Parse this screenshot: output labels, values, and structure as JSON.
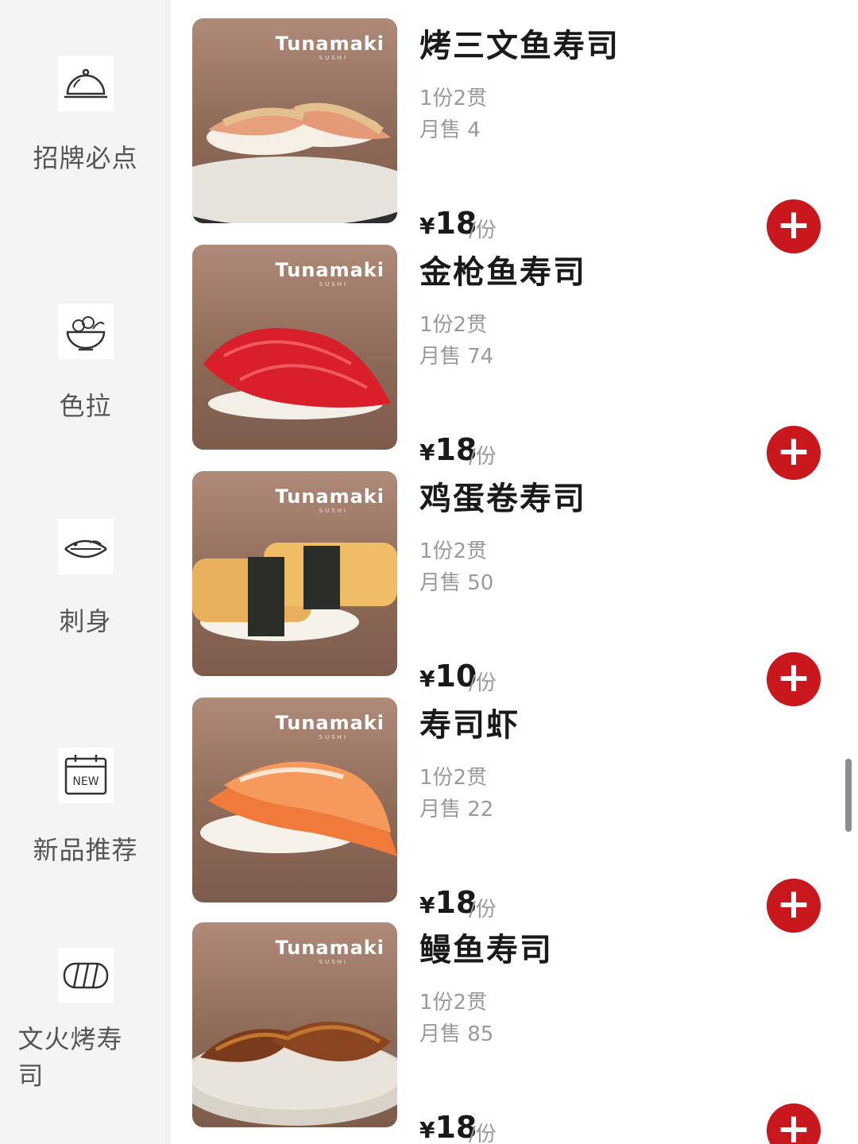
{
  "sidebar": {
    "categories": [
      {
        "label": "招牌必点",
        "icon": "cloche-icon"
      },
      {
        "label": "色拉",
        "icon": "salad-bowl-icon"
      },
      {
        "label": "刺身",
        "icon": "sashimi-icon"
      },
      {
        "label": "新品推荐",
        "icon": "new-calendar-icon",
        "icon_text": "NEW"
      },
      {
        "label": "文火烤寿司",
        "icon": "grilled-sushi-icon"
      }
    ]
  },
  "brand": {
    "name": "Tunamaki",
    "sub": "SUSHI"
  },
  "products": [
    {
      "name": "烤三文鱼寿司",
      "spec": "1份2贯",
      "sold": "月售 4",
      "currency": "¥",
      "price": "18",
      "unit": "/份"
    },
    {
      "name": "金枪鱼寿司",
      "spec": "1份2贯",
      "sold": "月售 74",
      "currency": "¥",
      "price": "18",
      "unit": "/份"
    },
    {
      "name": "鸡蛋卷寿司",
      "spec": "1份2贯",
      "sold": "月售 50",
      "currency": "¥",
      "price": "10",
      "unit": "/份"
    },
    {
      "name": "寿司虾",
      "spec": "1份2贯",
      "sold": "月售 22",
      "currency": "¥",
      "price": "18",
      "unit": "/份"
    },
    {
      "name": "鳗鱼寿司",
      "spec": "1份2贯",
      "sold": "月售 85",
      "currency": "¥",
      "price": "18",
      "unit": "/份"
    }
  ],
  "add_label": "+",
  "colors": {
    "accent": "#c8181e",
    "sidebar_bg": "#f4f4f4"
  }
}
